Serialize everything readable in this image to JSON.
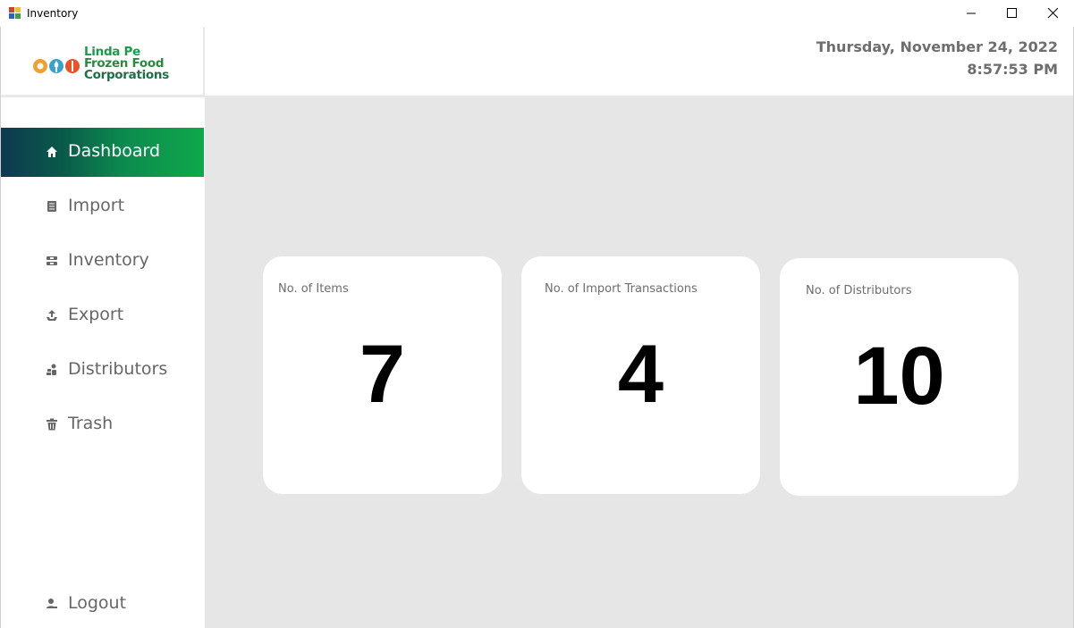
{
  "window": {
    "title": "Inventory",
    "minimize_icon": "minimize-icon",
    "maximize_icon": "maximize-icon",
    "close_icon": "close-icon"
  },
  "logo": {
    "line1": "Linda Pe",
    "line2": "Frozen Food",
    "line3": "Corporations",
    "circle_colors": [
      "#f0a030",
      "#3aa0d0",
      "#e8542a"
    ]
  },
  "header": {
    "date": "Thursday, November 24, 2022",
    "time": "8:57:53 PM"
  },
  "sidebar": {
    "items": [
      {
        "label": "Dashboard",
        "icon": "home-icon",
        "active": true
      },
      {
        "label": "Import",
        "icon": "book-icon",
        "active": false
      },
      {
        "label": "Inventory",
        "icon": "boxes-icon",
        "active": false
      },
      {
        "label": "Export",
        "icon": "export-icon",
        "active": false
      },
      {
        "label": "Distributors",
        "icon": "distributors-icon",
        "active": false
      },
      {
        "label": "Trash",
        "icon": "trash-icon",
        "active": false
      }
    ],
    "logout": {
      "label": "Logout",
      "icon": "logout-icon"
    }
  },
  "dashboard": {
    "cards": [
      {
        "label": "No. of Items",
        "value": "7"
      },
      {
        "label": "No. of Import Transactions",
        "value": "4"
      },
      {
        "label": "No. of Distributors",
        "value": "10"
      }
    ]
  },
  "colors": {
    "active_gradient_start": "#0d3a4f",
    "active_gradient_end": "#0fa84c",
    "main_background": "#e6e6e6",
    "nav_text": "#666666",
    "header_text": "#6e6e6e"
  }
}
